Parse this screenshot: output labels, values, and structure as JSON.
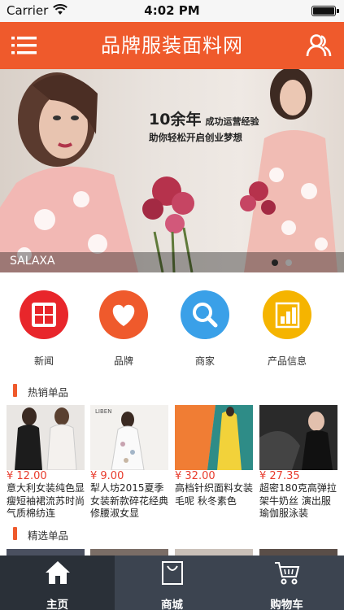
{
  "status_bar": {
    "carrier": "Carrier",
    "time": "4:02 PM"
  },
  "nav": {
    "title": "品牌服装面料网",
    "menu_icon": "menu-icon",
    "user_icon": "users-icon"
  },
  "banner": {
    "headline_big": "10余年",
    "headline_small": "成功运营经验",
    "headline_line2": "助你轻松开启创业梦想",
    "caption": "SALAXA",
    "slide_count": 2,
    "active_slide": 1
  },
  "categories": [
    {
      "label": "新闻",
      "icon": "grid-icon",
      "color": "#e8262b"
    },
    {
      "label": "品牌",
      "icon": "heart-icon",
      "color": "#ef5a2c"
    },
    {
      "label": "商家",
      "icon": "search-icon",
      "color": "#3aa0e8"
    },
    {
      "label": "产品信息",
      "icon": "bar-chart-icon",
      "color": "#f5b400"
    }
  ],
  "sections": {
    "hot": "热销单品",
    "featured": "精选单品"
  },
  "products": [
    {
      "price": "¥ 12.00",
      "name": "意大利女装纯色显瘦短袖裙流苏时尚气质棉纺连"
    },
    {
      "price": "¥ 9.00",
      "name": "犁人坊2015夏季女装新款碎花经典修腰淑女显"
    },
    {
      "price": "¥ 32.00",
      "name": "高档针织面料女装毛呢 秋冬素色"
    },
    {
      "price": "¥ 27.35",
      "name": "超密180克高弹拉架牛奶丝 演出服瑜伽服泳装"
    }
  ],
  "product_thumb_text": {
    "libel": "LIBEN"
  },
  "tabs": [
    {
      "label": "主页",
      "icon": "home-icon",
      "active": true
    },
    {
      "label": "商城",
      "icon": "shopping-bag-icon",
      "active": false
    },
    {
      "label": "购物车",
      "icon": "cart-icon",
      "active": false
    }
  ],
  "colors": {
    "brand": "#ef5a2c",
    "price": "#e83b2c",
    "tab_bar": "#3c4450"
  }
}
